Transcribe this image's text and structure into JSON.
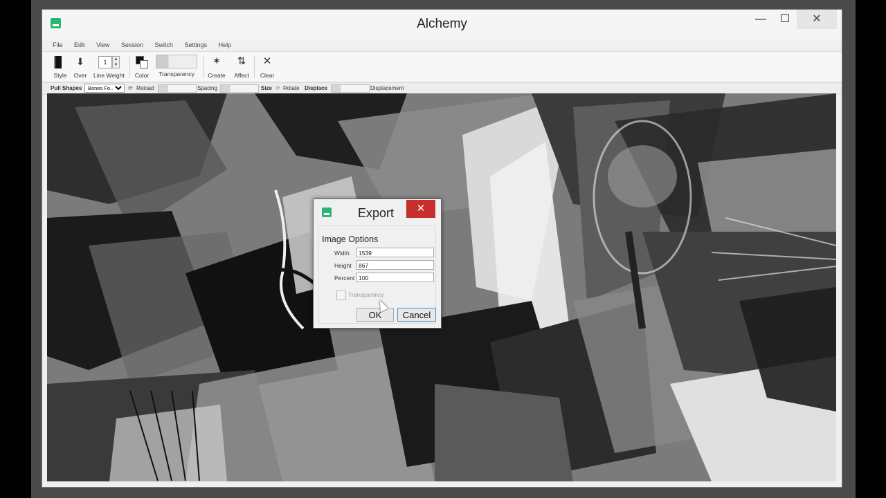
{
  "window": {
    "title": "Alchemy",
    "minimize_glyph": "—",
    "maximize_glyph": "☐",
    "close_glyph": "✕"
  },
  "menu": [
    "File",
    "Edit",
    "View",
    "Session",
    "Switch",
    "Settings",
    "Help"
  ],
  "toolbar": {
    "style_label": "Style",
    "over_label": "Over",
    "line_weight_label": "Line Weight",
    "line_weight_value": "1",
    "color_label": "Color",
    "transparency_label": "Transparency",
    "create_label": "Create",
    "affect_label": "Affect",
    "clear_label": "Clear"
  },
  "options_bar": {
    "pull_shapes_label": "Pull Shapes",
    "pull_shapes_value": "Bones Fo...",
    "reload_label": "Reload",
    "spacing_label": "Spacing",
    "size_label": "Size",
    "rotate_label": "Rotate",
    "displace_label": "Displace",
    "displacement_label": "Displacement"
  },
  "export_dialog": {
    "title": "Export",
    "close_glyph": "✕",
    "group_title": "Image Options",
    "width_label": "Width",
    "width_value": "1539",
    "height_label": "Height",
    "height_value": "867",
    "percent_label": "Percent",
    "percent_value": "100",
    "transparency_label": "Transparency",
    "transparency_checked": false,
    "ok_label": "OK",
    "cancel_label": "Cancel"
  },
  "colors": {
    "app_green": "#2bb673",
    "close_red": "#c7302a",
    "focus_blue": "#4a90d9"
  }
}
